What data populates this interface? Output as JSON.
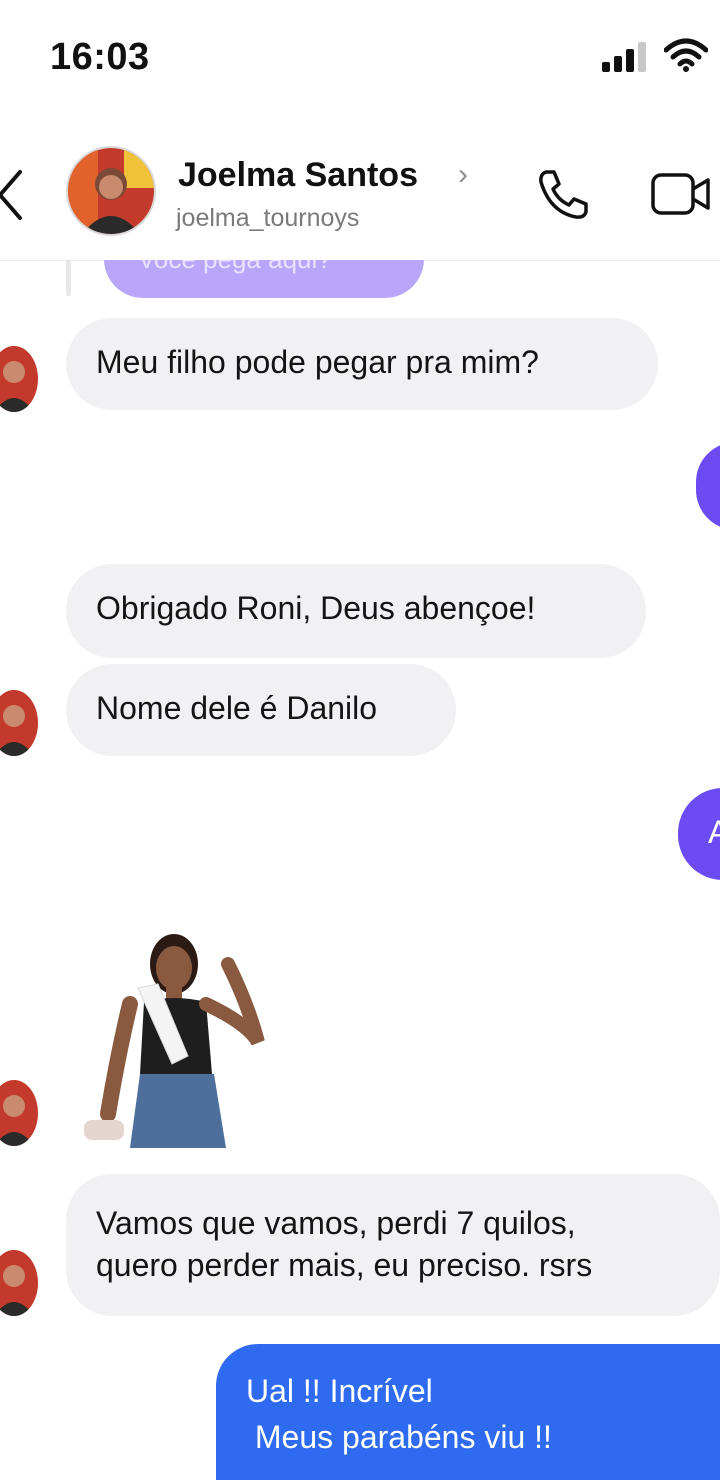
{
  "status_bar": {
    "time": "16:03"
  },
  "header": {
    "contact_name": "Joelma Santos",
    "username": "joelma_tournoys",
    "chevron": "›",
    "icons": [
      "back-chevron-icon",
      "phone-icon",
      "video-camera-icon"
    ]
  },
  "messages": {
    "partial_top_text": "Você pega aqui?",
    "m1": "Meu filho pode pegar pra mim?",
    "m2": "Obrigado Roni, Deus abençoe!",
    "m3": "Nome dele é Danilo",
    "m4_line1": "Vamos que vamos, perdi 7 quilos,",
    "m4_line2": "quero perder mais, eu preciso. rsrs",
    "out_partial_char": "A",
    "m5_line1": "Ual !! Incrível",
    "m5_line2": " Meus parabéns viu !!"
  },
  "colors": {
    "outgoing_purple": "#6c4bf3",
    "outgoing_blue": "#2f6bf0",
    "incoming_bg": "#f1f1f3"
  }
}
